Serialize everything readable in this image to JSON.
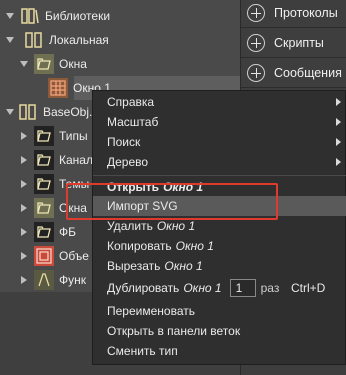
{
  "tree": {
    "items": [
      {
        "label": "Библиотеки",
        "icon": "library-icon",
        "expanded": true
      },
      {
        "label": "Локальная",
        "icon": "local-library-icon",
        "expanded": true
      },
      {
        "label": "Окна",
        "icon": "folder-icon",
        "expanded": true
      },
      {
        "label": "Окно 1",
        "icon": "window-icon",
        "expanded": null
      },
      {
        "label": "BaseObj...",
        "icon": "base-library-icon",
        "expanded": true
      },
      {
        "label": "Типы",
        "icon": "folder-icon",
        "expanded": false
      },
      {
        "label": "Канал",
        "icon": "folder-icon",
        "expanded": false
      },
      {
        "label": "Темы",
        "icon": "folder-icon",
        "expanded": false
      },
      {
        "label": "Окна",
        "icon": "folder-icon",
        "expanded": false
      },
      {
        "label": "ФБ",
        "icon": "folder-icon",
        "expanded": false
      },
      {
        "label": "Объе",
        "icon": "object-icon",
        "expanded": false
      },
      {
        "label": "Функ",
        "icon": "function-icon",
        "expanded": false
      }
    ]
  },
  "right_panel": {
    "buttons": [
      {
        "label": "Протоколы"
      },
      {
        "label": "Скрипты"
      },
      {
        "label": "Сообщения"
      }
    ]
  },
  "menu": {
    "help": "Справка",
    "zoom": "Масштаб",
    "search": "Поиск",
    "tree": "Дерево",
    "open": "Открыть",
    "open_target": "Окно 1",
    "import_svg": "Импорт SVG",
    "delete": "Удалить",
    "delete_target": "Окно 1",
    "copy": "Копировать",
    "copy_target": "Окно 1",
    "cut": "Вырезать",
    "cut_target": "Окно 1",
    "duplicate": "Дублировать",
    "duplicate_target": "Окно 1",
    "duplicate_count": "1",
    "duplicate_unit": "раз",
    "duplicate_shortcut": "Ctrl+D",
    "rename": "Переименовать",
    "open_in_branch_panel": "Открыть в панели веток",
    "change_type": "Сменить тип"
  },
  "colors": {
    "highlight_box": "#e03a2f",
    "menu_bg": "#2f2f2f",
    "tree_bg": "#4a4a4a"
  }
}
